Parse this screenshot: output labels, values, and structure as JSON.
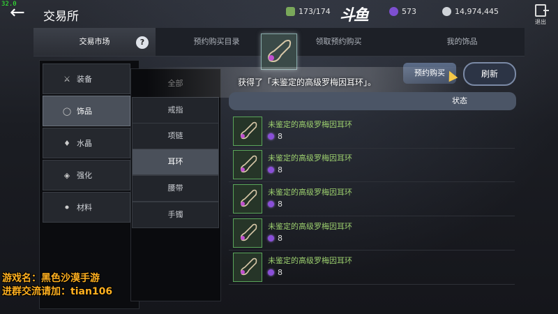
{
  "fps": "32.0",
  "header": {
    "title": "交易所",
    "stamina": "173/174",
    "logo_text": "斗鱼",
    "purple_currency": "573",
    "silver": "14,974,445",
    "exit_label": "退出"
  },
  "tabs": [
    "交易市场",
    "预约购买目录",
    "领取预约购买",
    "我的饰品"
  ],
  "help_badge": "?",
  "categories": [
    {
      "label": "装备",
      "icon": "crossed-swords-icon"
    },
    {
      "label": "饰品",
      "icon": "ring-icon"
    },
    {
      "label": "水晶",
      "icon": "gem-icon"
    },
    {
      "label": "强化",
      "icon": "diamond-arrow-icon"
    },
    {
      "label": "材料",
      "icon": "flask-icon"
    }
  ],
  "subcategories": [
    "全部",
    "戒指",
    "项链",
    "耳环",
    "腰带",
    "手镯"
  ],
  "notification": "获得了「未鉴定的高级罗梅因耳环」。",
  "buttons": {
    "buy": "预约购买",
    "refresh": "刷新"
  },
  "list_header": {
    "status": "状态"
  },
  "items": [
    {
      "name": "未鉴定的高级罗梅因耳环",
      "price": "8"
    },
    {
      "name": "未鉴定的高级罗梅因耳环",
      "price": "8"
    },
    {
      "name": "未鉴定的高级罗梅因耳环",
      "price": "8"
    },
    {
      "name": "未鉴定的高级罗梅因耳环",
      "price": "8"
    },
    {
      "name": "未鉴定的高级罗梅因耳环",
      "price": "8"
    }
  ],
  "overlay": {
    "line1": "游戏名：黑色沙漠手游",
    "line2": "进群交流请加：tian106"
  },
  "colors": {
    "item_name": "#9ccf6e",
    "promo_text": "#ffb020",
    "currency_orb": "#8a4fd8"
  }
}
